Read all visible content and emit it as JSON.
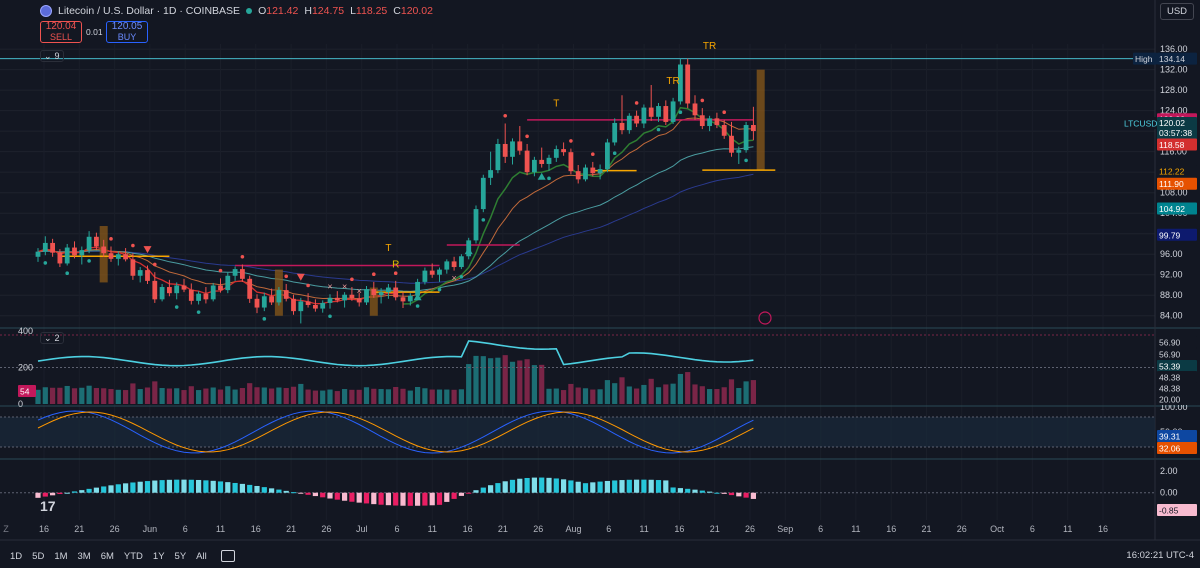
{
  "legend": {
    "title": "Litecoin / U.S. Dollar · 1D · COINBASE",
    "open": "121.42",
    "high": "124.75",
    "low": "118.25",
    "close": "120.02",
    "o_prefix": "O",
    "h_prefix": "H",
    "l_prefix": "L",
    "c_prefix": "C"
  },
  "trade": {
    "sell_price": "120.04",
    "sell_label": "SELL",
    "spread": "0.01",
    "buy_price": "120.05",
    "buy_label": "BUY"
  },
  "currency": "USD",
  "indicators": {
    "main_count": "9",
    "volume_count": "2"
  },
  "price_axis": {
    "ticks": [
      "136.00",
      "132.00",
      "128.00",
      "124.00",
      "120.00",
      "116.00",
      "112.00",
      "108.00",
      "104.00",
      "100.00",
      "96.00",
      "92.00",
      "88.00",
      "84.00"
    ],
    "labels": {
      "high_tag": "High",
      "high": "134.14",
      "r1": "122.33",
      "symbol": "LTCUSD",
      "last": "120.02",
      "countdown": "03:57:38",
      "s1": "118.58",
      "l1": "112.22",
      "l2": "111.90",
      "l3": "104.92",
      "l4": "99.79"
    }
  },
  "volume_axis": {
    "ticks": [
      "400",
      "200",
      "0"
    ],
    "badge": "54",
    "labels": [
      "56.90",
      "56.90",
      "53.39",
      "48.38",
      "48.38",
      "20.00"
    ]
  },
  "stoch_axis": {
    "ticks": [
      "100.00",
      "50.00"
    ],
    "k": "39.31",
    "d": "32.06"
  },
  "macd_axis": {
    "ticks": [
      "2.00",
      "0.00"
    ],
    "value": "-0.85"
  },
  "time_axis": {
    "labels": [
      "Z",
      "16",
      "21",
      "26",
      "Jun",
      "6",
      "11",
      "16",
      "21",
      "26",
      "Jul",
      "6",
      "11",
      "16",
      "21",
      "26",
      "Aug",
      "6",
      "11",
      "16",
      "21",
      "26",
      "Sep",
      "6",
      "11",
      "16",
      "21",
      "26",
      "Oct",
      "6",
      "11",
      "16"
    ]
  },
  "bottom": {
    "timeframes": [
      "1D",
      "5D",
      "1M",
      "3M",
      "6M",
      "YTD",
      "1Y",
      "5Y",
      "All"
    ],
    "clock": "16:02:21 UTC-4"
  },
  "markers": [
    "T",
    "T",
    "TR",
    "R",
    "TR"
  ],
  "colors": {
    "up": "#26a69a",
    "down": "#ef5350",
    "bg": "#131722",
    "orange": "#f7a600",
    "cyan": "#4dd0e1"
  },
  "chart_data": {
    "type": "candlestick",
    "symbol": "LTCUSD",
    "interval": "1D",
    "ylim": [
      82,
      137
    ],
    "candles": [
      [
        95.5,
        97.2,
        94.5,
        96.5
      ],
      [
        96.5,
        99.5,
        95.8,
        98.2
      ],
      [
        98.2,
        99.0,
        95.5,
        96.3
      ],
      [
        96.3,
        97.0,
        93.5,
        94.2
      ],
      [
        94.2,
        98.0,
        93.8,
        97.3
      ],
      [
        97.3,
        98.5,
        95.2,
        95.8
      ],
      [
        95.8,
        97.5,
        94.0,
        96.8
      ],
      [
        96.8,
        100.5,
        96.2,
        99.4
      ],
      [
        99.4,
        100.2,
        96.8,
        97.5
      ],
      [
        97.5,
        98.8,
        95.5,
        96.2
      ],
      [
        96.2,
        97.5,
        94.5,
        95.1
      ],
      [
        95.1,
        96.5,
        93.8,
        96.0
      ],
      [
        96.0,
        97.2,
        94.6,
        95.0
      ],
      [
        95.0,
        96.2,
        91.0,
        91.8
      ],
      [
        91.8,
        93.5,
        90.5,
        92.9
      ],
      [
        92.9,
        93.8,
        90.2,
        90.8
      ],
      [
        90.8,
        92.5,
        86.5,
        87.2
      ],
      [
        87.2,
        90.2,
        86.8,
        89.6
      ],
      [
        89.6,
        91.0,
        87.8,
        88.4
      ],
      [
        88.4,
        90.5,
        87.2,
        89.9
      ],
      [
        89.9,
        91.2,
        88.6,
        89.1
      ],
      [
        89.1,
        90.3,
        86.2,
        86.9
      ],
      [
        86.9,
        88.8,
        86.2,
        88.3
      ],
      [
        88.3,
        89.6,
        86.4,
        87.2
      ],
      [
        87.2,
        90.4,
        86.8,
        89.9
      ],
      [
        89.9,
        91.3,
        88.5,
        89.0
      ],
      [
        89.0,
        92.5,
        88.4,
        91.8
      ],
      [
        91.8,
        93.6,
        90.8,
        93.1
      ],
      [
        93.1,
        94.0,
        90.6,
        91.2
      ],
      [
        91.2,
        91.8,
        86.5,
        87.3
      ],
      [
        87.3,
        88.2,
        84.5,
        85.6
      ],
      [
        85.6,
        88.5,
        84.9,
        87.8
      ],
      [
        87.8,
        89.3,
        86.1,
        86.6
      ],
      [
        86.6,
        89.6,
        86.0,
        89.0
      ],
      [
        89.0,
        90.2,
        86.8,
        87.3
      ],
      [
        87.3,
        88.1,
        84.2,
        84.9
      ],
      [
        84.9,
        87.5,
        82.5,
        86.8
      ],
      [
        86.8,
        88.4,
        85.6,
        86.1
      ],
      [
        86.1,
        87.2,
        84.8,
        85.4
      ],
      [
        85.4,
        87.0,
        84.6,
        86.5
      ],
      [
        86.5,
        88.2,
        85.4,
        87.5
      ],
      [
        87.5,
        88.8,
        86.6,
        87.0
      ],
      [
        87.0,
        88.6,
        85.6,
        88.1
      ],
      [
        88.1,
        89.6,
        86.9,
        87.4
      ],
      [
        87.4,
        88.5,
        85.8,
        86.6
      ],
      [
        86.6,
        89.8,
        86.1,
        89.2
      ],
      [
        89.2,
        90.6,
        87.5,
        88.0
      ],
      [
        88.0,
        89.4,
        86.4,
        88.6
      ],
      [
        88.6,
        90.2,
        87.3,
        89.5
      ],
      [
        89.5,
        90.8,
        87.0,
        87.6
      ],
      [
        87.6,
        88.6,
        85.5,
        86.8
      ],
      [
        86.8,
        88.4,
        86.0,
        87.9
      ],
      [
        87.9,
        91.2,
        87.4,
        90.6
      ],
      [
        90.6,
        93.4,
        90.1,
        92.8
      ],
      [
        92.8,
        94.2,
        91.4,
        92.0
      ],
      [
        92.0,
        93.4,
        90.6,
        93.0
      ],
      [
        93.0,
        95.0,
        92.2,
        94.6
      ],
      [
        94.6,
        95.5,
        92.8,
        93.5
      ],
      [
        93.5,
        96.0,
        93.1,
        95.6
      ],
      [
        95.6,
        99.2,
        95.0,
        98.7
      ],
      [
        98.7,
        105.5,
        98.1,
        104.8
      ],
      [
        104.8,
        111.5,
        104.2,
        110.9
      ],
      [
        110.9,
        116.0,
        109.5,
        112.4
      ],
      [
        112.4,
        118.5,
        111.8,
        117.5
      ],
      [
        117.5,
        121.5,
        113.8,
        115.0
      ],
      [
        115.0,
        118.6,
        113.5,
        118.0
      ],
      [
        118.0,
        121.0,
        115.4,
        116.2
      ],
      [
        116.2,
        117.5,
        111.4,
        112.0
      ],
      [
        112.0,
        115.0,
        111.2,
        114.4
      ],
      [
        114.4,
        116.8,
        112.9,
        113.6
      ],
      [
        113.6,
        115.4,
        112.3,
        114.8
      ],
      [
        114.8,
        117.2,
        114.0,
        116.5
      ],
      [
        116.5,
        117.8,
        115.2,
        115.9
      ],
      [
        115.9,
        116.6,
        111.6,
        112.2
      ],
      [
        112.2,
        113.4,
        109.8,
        110.6
      ],
      [
        110.6,
        113.5,
        110.2,
        112.9
      ],
      [
        112.9,
        114.0,
        111.2,
        111.8
      ],
      [
        111.8,
        113.5,
        110.6,
        112.6
      ],
      [
        112.6,
        118.5,
        112.0,
        117.8
      ],
      [
        117.8,
        122.5,
        117.2,
        121.6
      ],
      [
        121.6,
        127.0,
        119.4,
        120.2
      ],
      [
        120.2,
        123.5,
        119.5,
        123.0
      ],
      [
        123.0,
        124.0,
        120.8,
        121.5
      ],
      [
        121.5,
        125.2,
        120.6,
        124.6
      ],
      [
        124.6,
        129.0,
        122.0,
        122.8
      ],
      [
        122.8,
        125.5,
        121.8,
        124.9
      ],
      [
        124.9,
        126.0,
        121.2,
        121.8
      ],
      [
        121.8,
        126.5,
        121.4,
        125.8
      ],
      [
        125.8,
        134.1,
        125.2,
        133.0
      ],
      [
        133.0,
        134.14,
        124.5,
        125.4
      ],
      [
        125.4,
        127.0,
        122.2,
        123.1
      ],
      [
        123.1,
        124.5,
        120.4,
        121.0
      ],
      [
        121.0,
        123.0,
        120.0,
        122.5
      ],
      [
        122.5,
        123.6,
        120.6,
        121.2
      ],
      [
        121.2,
        122.2,
        118.5,
        119.1
      ],
      [
        119.1,
        121.8,
        115.0,
        115.8
      ],
      [
        115.8,
        117.0,
        113.6,
        116.3
      ],
      [
        116.3,
        121.8,
        115.8,
        121.2
      ],
      [
        121.2,
        124.75,
        118.25,
        120.02
      ]
    ],
    "ema_fast_last": 118.58,
    "ema_mid_last": 112.22,
    "ema_slow_last": 104.92,
    "ema_long_last": 99.79,
    "high_line": 134.14,
    "volume_ylim": [
      0,
      400
    ],
    "stoch_ylim": [
      0,
      100
    ],
    "macd_ylim": [
      -2.5,
      3
    ]
  }
}
